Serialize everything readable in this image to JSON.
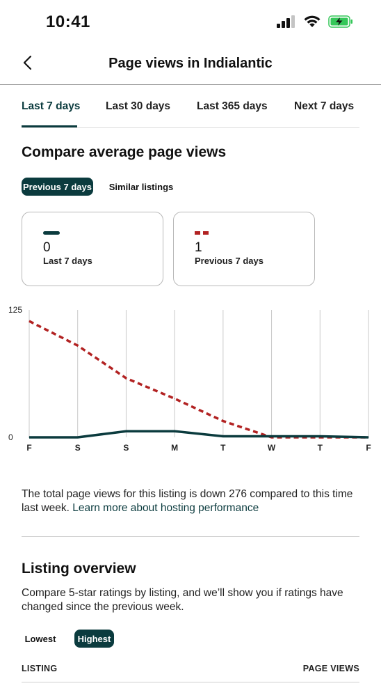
{
  "status_bar": {
    "time": "10:41"
  },
  "header": {
    "title": "Page views in Indialantic"
  },
  "tabs": [
    {
      "label": "Last 7 days",
      "active": true
    },
    {
      "label": "Last 30 days",
      "active": false
    },
    {
      "label": "Last 365 days",
      "active": false
    },
    {
      "label": "Next 7 days",
      "active": false
    }
  ],
  "compare": {
    "title": "Compare average page views",
    "filters": [
      {
        "label": "Previous 7 days",
        "selected": true
      },
      {
        "label": "Similar listings",
        "selected": false
      }
    ],
    "cards": [
      {
        "value": "0",
        "label": "Last 7 days",
        "color": "#0b3b3e",
        "style": "solid"
      },
      {
        "value": "1",
        "label": "Previous 7 days",
        "color": "#b22222",
        "style": "dashed"
      }
    ]
  },
  "chart_data": {
    "type": "line",
    "x": [
      "F",
      "S",
      "S",
      "M",
      "T",
      "W",
      "T",
      "F"
    ],
    "y_ticks": [
      "125",
      "0"
    ],
    "ylim": [
      0,
      125
    ],
    "grid": true,
    "series": [
      {
        "name": "Last 7 days",
        "color": "#0b3b3e",
        "style": "solid",
        "values": [
          0,
          0,
          6,
          6,
          1,
          1,
          1,
          0
        ]
      },
      {
        "name": "Previous 7 days",
        "color": "#b22222",
        "style": "dashed",
        "values": [
          114,
          90,
          58,
          38,
          16,
          0,
          0,
          0
        ]
      }
    ]
  },
  "summary": {
    "text": "The total page views for this listing is down 276 compared to this time last week. ",
    "link": "Learn more about hosting performance"
  },
  "overview": {
    "title": "Listing overview",
    "description": "Compare 5-star ratings by listing, and we’ll show you if ratings have changed since the previous week.",
    "filters": [
      {
        "label": "Lowest",
        "selected": false
      },
      {
        "label": "Highest",
        "selected": true
      }
    ],
    "columns": {
      "listing": "LISTING",
      "page_views": "PAGE VIEWS"
    }
  },
  "colors": {
    "accent": "#0b3b3e",
    "previous": "#b22222",
    "battery": "#34c759"
  },
  "icons": [
    "signal-icon",
    "wifi-icon",
    "battery-charging-icon",
    "chevron-left-icon"
  ]
}
